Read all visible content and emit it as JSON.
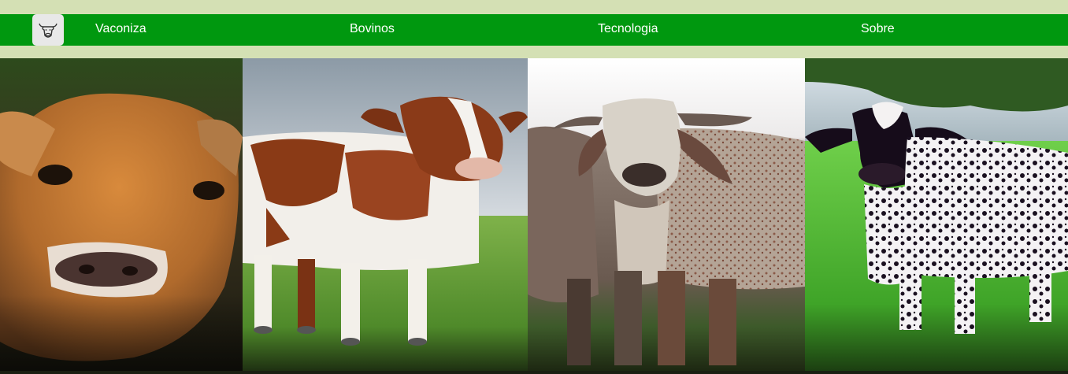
{
  "navbar": {
    "logo_icon": "cow-head-icon",
    "links": [
      "Vaconiza",
      "Bovinos",
      "Tecnologia",
      "Sobre"
    ],
    "bar_color": "#00980f",
    "band_color": "#d4e0b4"
  },
  "gallery": {
    "panels": [
      {
        "name": "jersey-cow-photo",
        "coat": "#c0702a"
      },
      {
        "name": "red-white-holstein-photo",
        "coat": "#8a3a18"
      },
      {
        "name": "gir-cow-photo",
        "coat": "#9a7a68"
      },
      {
        "name": "black-white-spotted-cow-photo",
        "coat": "#1a1020"
      }
    ]
  }
}
